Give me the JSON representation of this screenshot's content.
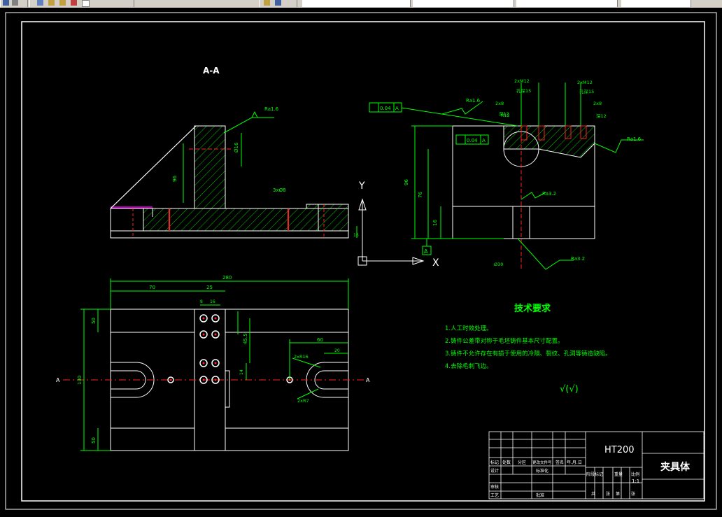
{
  "colors": {
    "lines": "#ffffff",
    "dims": "#00ff00",
    "center": "#ff2020",
    "hatch": "#00ff00",
    "annot": "#ffff00"
  },
  "views": {
    "section_label": "A-A",
    "axis_y": "Y",
    "axis_x": "X",
    "axis_a": "A",
    "cut_left": "A",
    "cut_right": "A"
  },
  "annotations": {
    "rough_1": "Ra1.6",
    "rough_2": "Ra1.6",
    "rough_3": "Ra1.6",
    "rough_4": "Ra3.2",
    "rough_5": "Ra3.2",
    "gtol_1": "0.04",
    "gtol_1_ref": "A",
    "gtol_2": "0.04",
    "gtol_2_ref": "A",
    "hole_1a": "2xM12",
    "hole_1b": "孔深15",
    "hole_2a": "2xM12",
    "hole_2b": "孔深15",
    "hole_3": "2x8",
    "hole_4": "2x8",
    "hole_5": "深12",
    "hole_6": "深12",
    "dim_r1": "Ø16",
    "dim_h1": "96",
    "dim_h2": "76",
    "dim_h3": "16",
    "dim_b1": "16",
    "dim_w1": "280",
    "dim_w2": "70",
    "dim_w3": "25",
    "dim_w4": "8",
    "dim_w5": "16",
    "dim_w6": "60",
    "dim_w7": "20",
    "dim_h4": "50",
    "dim_h5": "130",
    "dim_h6": "50",
    "dim_h7": "45.5",
    "dim_h8": "14",
    "dim_r2": "2xR16",
    "dim_r3": "2xR7",
    "dim_s1": "R12",
    "dim_s2": "Ø30",
    "dim_s3": "3xØ8"
  },
  "tech": {
    "title": "技术要求",
    "items": [
      "1.人工时效处理。",
      "2.铸件公差带对称于毛坯铸件基本尺寸配置。",
      "3.铸件不允许存在有损于使用的冷隔、裂纹、孔洞等铸造缺陷。",
      "4.去除毛刺飞边。"
    ],
    "symbol": "√(√)"
  },
  "titleblock": {
    "material": "HT200",
    "part_name": "夹具体",
    "scale": "1:1",
    "r_mark": "标记",
    "r_count": "处数",
    "r_zone": "分区",
    "r_doc": "更改文件号",
    "r_sign": "签名",
    "r_date": "年.月.日",
    "r_design": "设计",
    "r_std": "标准化",
    "r_stage": "阶段标记",
    "r_weight": "重量",
    "r_ratio": "比例",
    "r_check": "审核",
    "r_process": "工艺",
    "r_approve": "批准",
    "r_total": "共",
    "r_sheet": "张",
    "r_of": "第",
    "r_sheet2": "张"
  }
}
